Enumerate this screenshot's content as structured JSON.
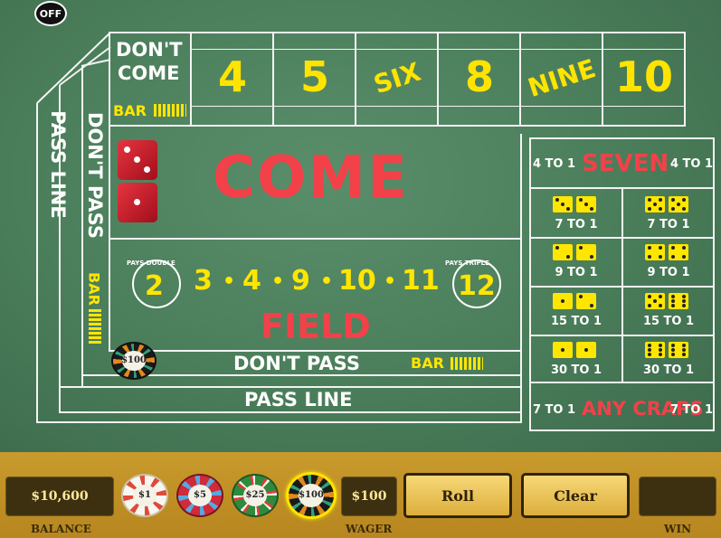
{
  "sound_toggle": "OFF",
  "table": {
    "dont_come_line1": "DON'T",
    "dont_come_line2": "COME",
    "dont_come_bar": "BAR",
    "point_numbers": [
      "4",
      "5",
      "SIX",
      "8",
      "NINE",
      "10"
    ],
    "come": "COME",
    "pass_line_vertical": "PASS LINE",
    "dont_pass_vertical": "DON'T PASS",
    "bar_vertical": "BAR",
    "field": {
      "pays_double_label": "PAYS DOUBLE",
      "double_number": "2",
      "numbers": [
        "3",
        "4",
        "9",
        "10",
        "11"
      ],
      "dot": "•",
      "pays_triple_label": "PAYS TRIPLE",
      "triple_number": "12",
      "label": "FIELD"
    },
    "dont_pass": "DON'T PASS",
    "dont_pass_bar": "BAR",
    "pass_line": "PASS LINE",
    "table_chip": "$100"
  },
  "proposition": {
    "seven_left_odds": "4 TO 1",
    "seven": "SEVEN",
    "seven_right_odds": "4 TO 1",
    "hardways": [
      {
        "odds": "7 TO 1"
      },
      {
        "odds": "7 TO 1"
      },
      {
        "odds": "9 TO 1"
      },
      {
        "odds": "9 TO 1"
      },
      {
        "odds": "15 TO 1"
      },
      {
        "odds": "15 TO 1"
      },
      {
        "odds": "30 TO 1"
      },
      {
        "odds": "30 TO 1"
      }
    ],
    "any_craps_left_odds": "7 TO 1",
    "any_craps": "ANY CRAPS",
    "any_craps_right_odds": "7 TO 1"
  },
  "controls": {
    "balance_value": "$10,600",
    "balance_label": "BALANCE",
    "chips": [
      "$1",
      "$5",
      "$25",
      "$100"
    ],
    "wager_value": "$100",
    "wager_label": "WAGER",
    "roll_button": "Roll",
    "clear_button": "Clear",
    "win_value": "",
    "win_label": "WIN"
  },
  "colors": {
    "felt": "#4a7d5a",
    "text_yellow": "#ffe600",
    "text_red": "#f4434a",
    "bar": "#c99a2c"
  }
}
